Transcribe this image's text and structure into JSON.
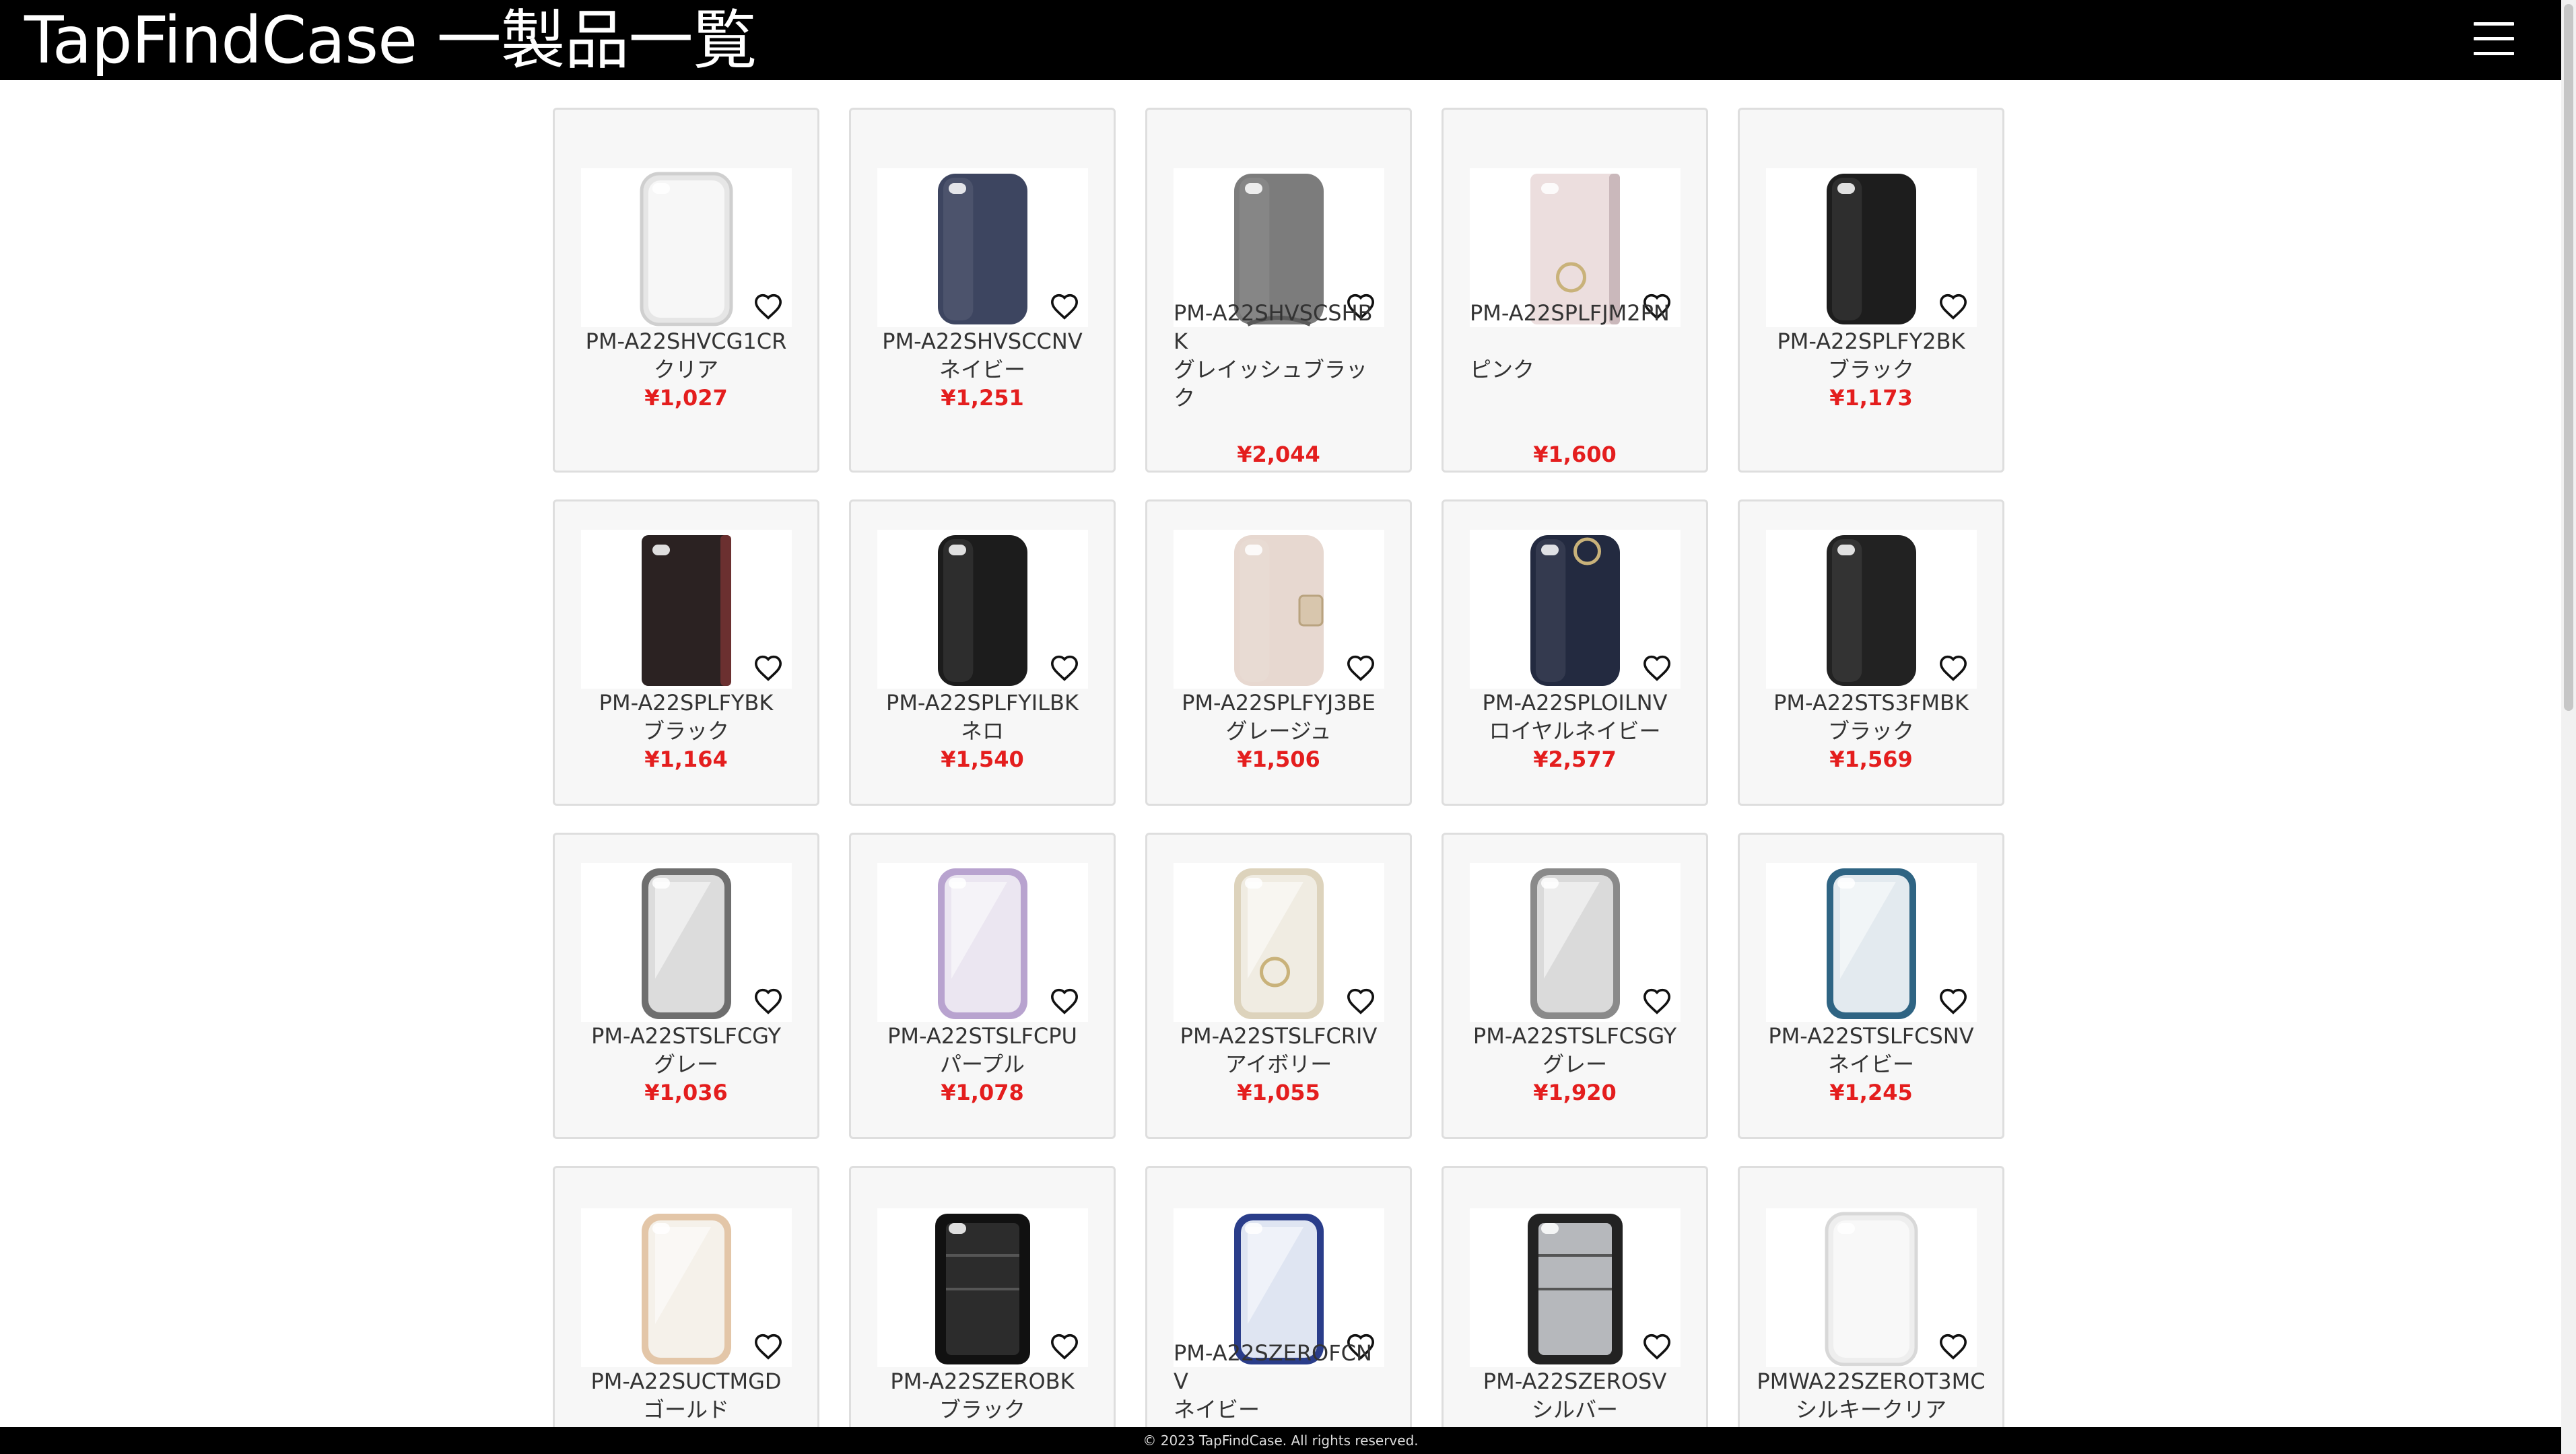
{
  "header": {
    "title": "TapFindCase 一製品一覧"
  },
  "products": [
    {
      "code": "PM-A22SHVCG1CR",
      "color": "クリア",
      "price": "¥1,027"
    },
    {
      "code": "PM-A22SHVSCCNV",
      "color": "ネイビー",
      "price": "¥1,251"
    },
    {
      "code": "PM-A22SHVSCSHBK",
      "color": "グレイッシュブラック",
      "price": "¥2,044"
    },
    {
      "code": "PM-A22SPLFJM2PN",
      "color": "ピンク",
      "price": "¥1,600"
    },
    {
      "code": "PM-A22SPLFY2BK",
      "color": "ブラック",
      "price": "¥1,173"
    },
    {
      "code": "PM-A22SPLFYBK",
      "color": "ブラック",
      "price": "¥1,164"
    },
    {
      "code": "PM-A22SPLFYILBK",
      "color": "ネロ",
      "price": "¥1,540"
    },
    {
      "code": "PM-A22SPLFYJ3BE",
      "color": "グレージュ",
      "price": "¥1,506"
    },
    {
      "code": "PM-A22SPLOILNV",
      "color": "ロイヤルネイビー",
      "price": "¥2,577"
    },
    {
      "code": "PM-A22STS3FMBK",
      "color": "ブラック",
      "price": "¥1,569"
    },
    {
      "code": "PM-A22STSLFCGY",
      "color": "グレー",
      "price": "¥1,036"
    },
    {
      "code": "PM-A22STSLFCPU",
      "color": "パープル",
      "price": "¥1,078"
    },
    {
      "code": "PM-A22STSLFCRIV",
      "color": "アイボリー",
      "price": "¥1,055"
    },
    {
      "code": "PM-A22STSLFCSGY",
      "color": "グレー",
      "price": "¥1,920"
    },
    {
      "code": "PM-A22STSLFCSNV",
      "color": "ネイビー",
      "price": "¥1,245"
    },
    {
      "code": "PM-A22SUCTMGD",
      "color": "ゴールド",
      "price": ""
    },
    {
      "code": "PM-A22SZEROBK",
      "color": "ブラック",
      "price": ""
    },
    {
      "code": "PM-A22SZEROFCNV",
      "color": "ネイビー",
      "price": ""
    },
    {
      "code": "PM-A22SZEROSV",
      "color": "シルバー",
      "price": ""
    },
    {
      "code": "PMWA22SZEROT3MC",
      "color": "シルキークリア",
      "price": ""
    }
  ],
  "footer": {
    "copyright": "© 2023 TapFindCase. All rights reserved."
  },
  "icons": {
    "menu": "hamburger-menu-icon",
    "favorite": "heart-icon"
  }
}
